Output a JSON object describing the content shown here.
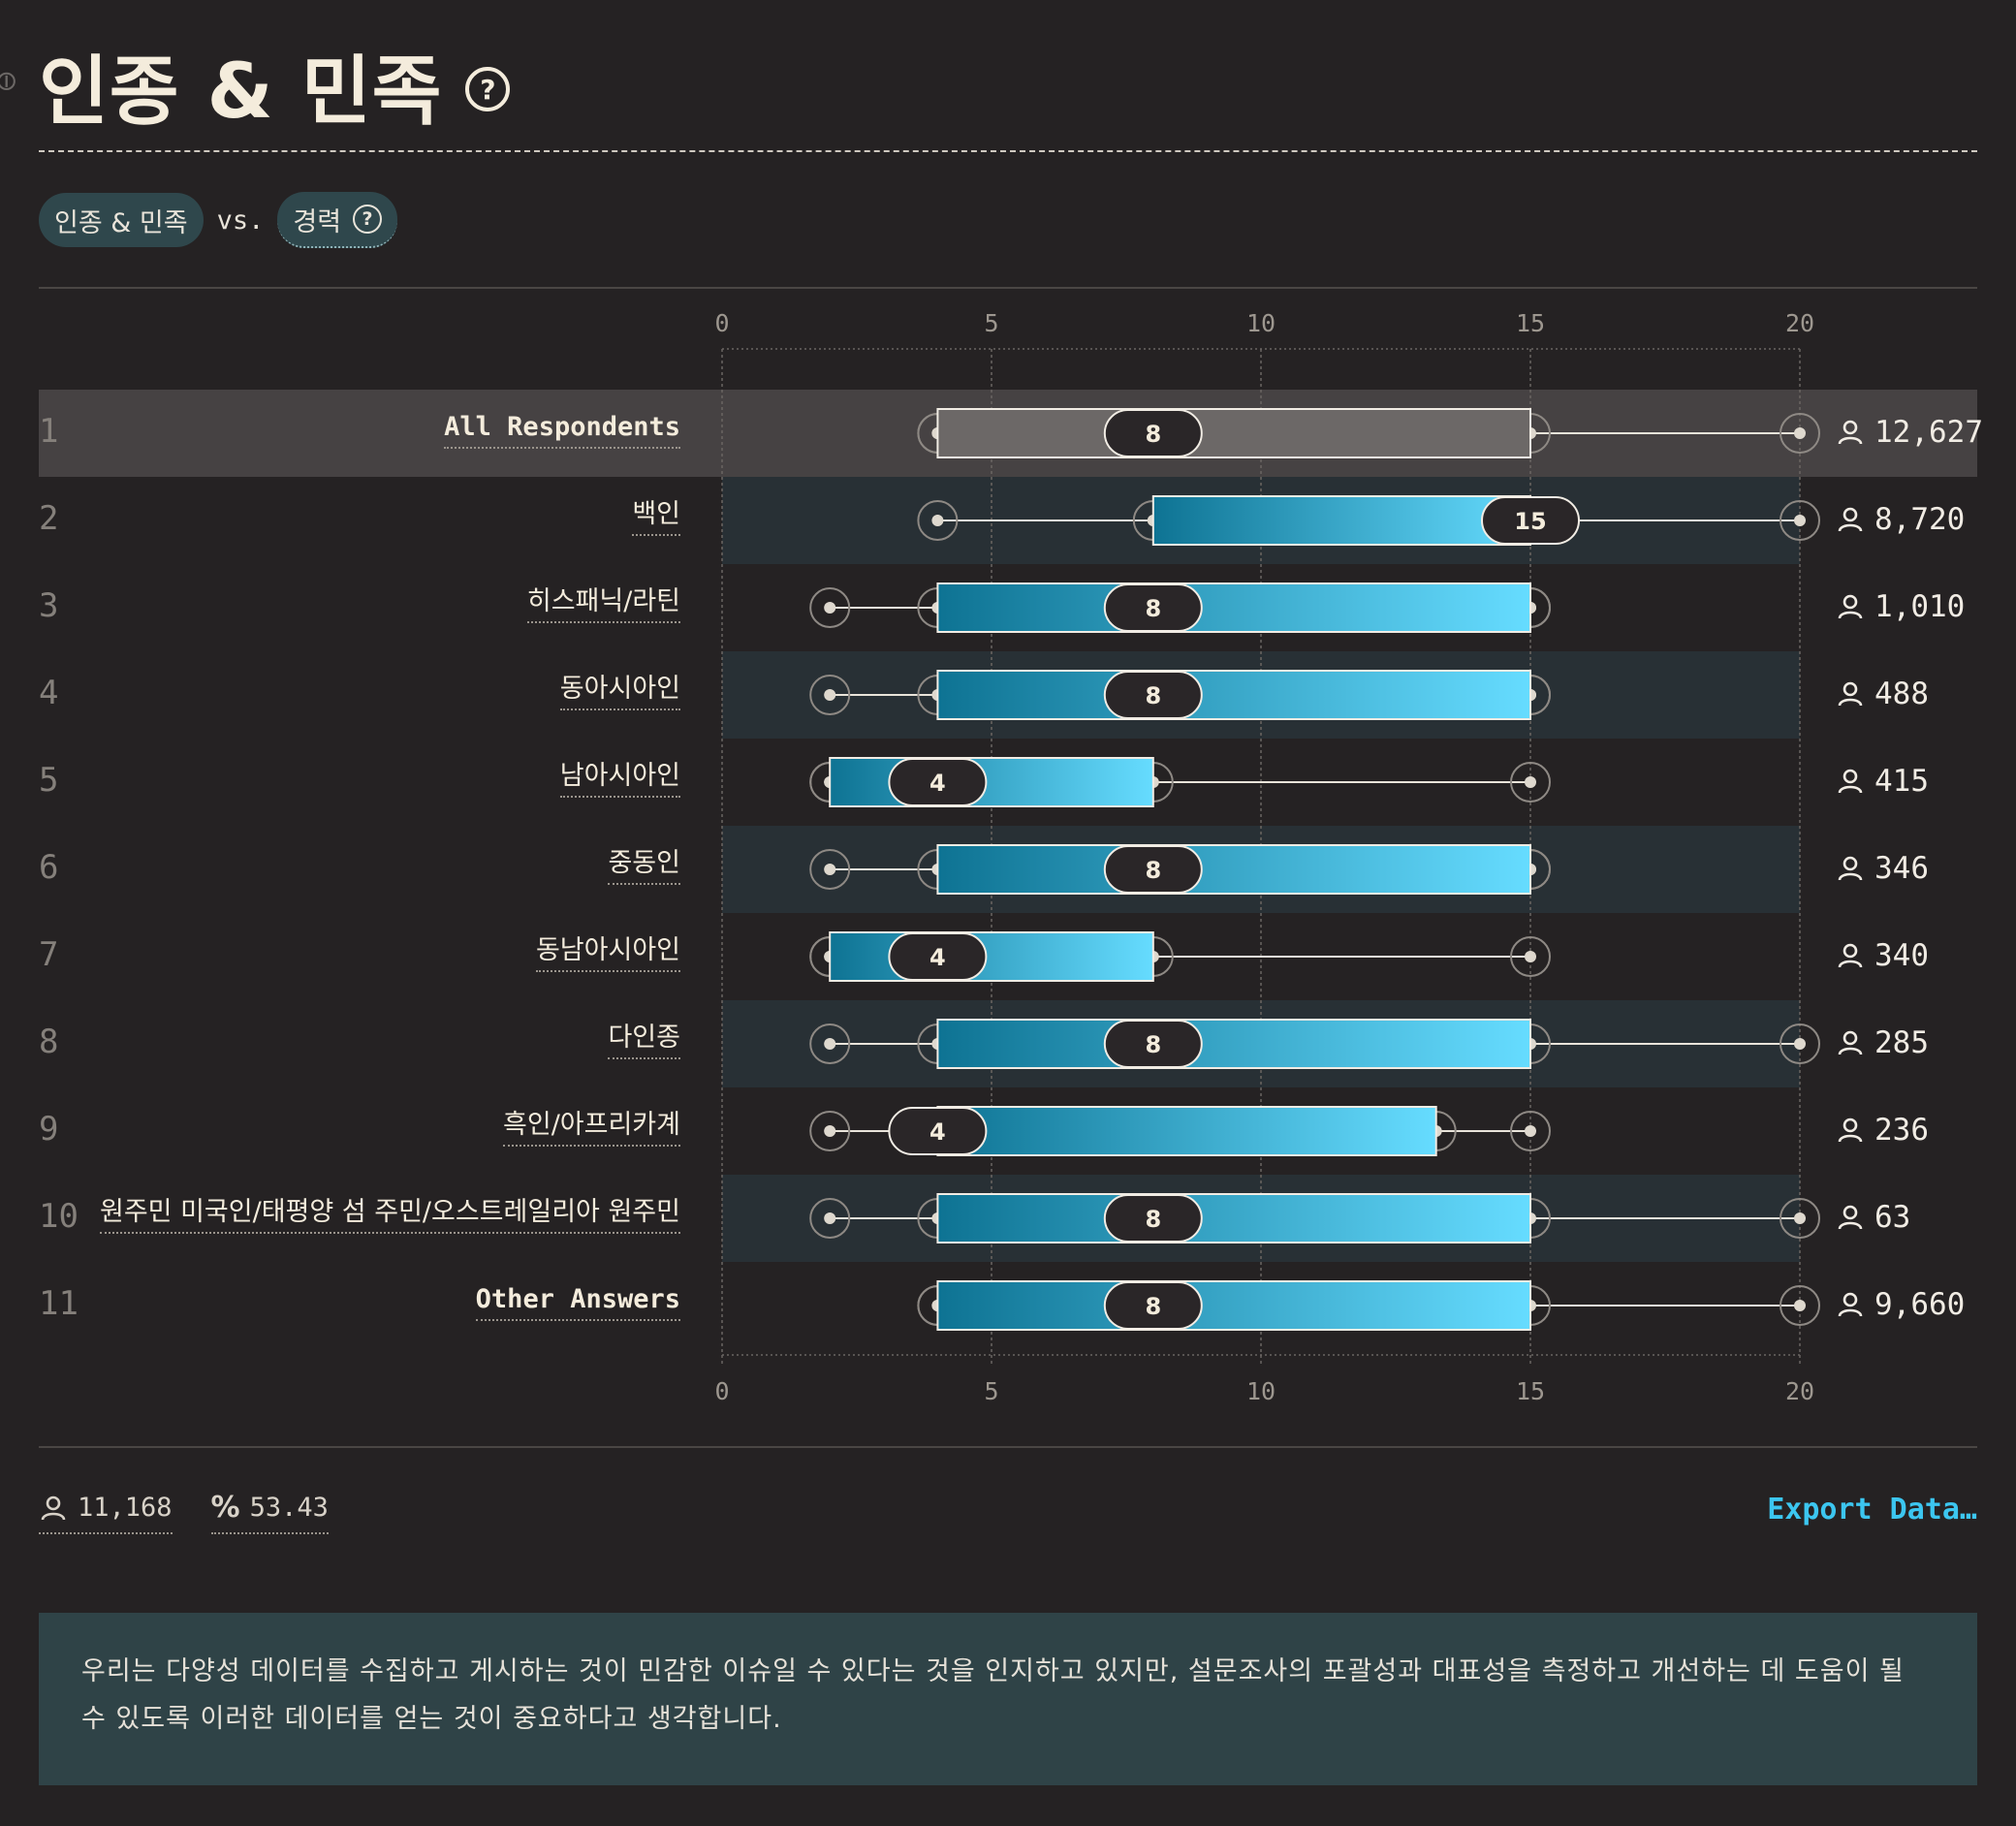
{
  "header": {
    "title": "인종 & 민족",
    "filter_primary": "인종 & 민족",
    "vs_label": "vs.",
    "filter_secondary": "경력"
  },
  "chart_data": {
    "type": "boxplot",
    "title": "인종 & 민족",
    "xlabel": "경력",
    "xlim": [
      0,
      20
    ],
    "xticks": [
      0,
      5,
      10,
      15,
      20
    ],
    "grid": true,
    "rows": [
      {
        "rank": "1",
        "label": "All Respondents",
        "min": 4,
        "q1": 4,
        "median": 8,
        "q3": 15,
        "max": 20,
        "count": "12,627",
        "highlight": true
      },
      {
        "rank": "2",
        "label": "백인",
        "min": 4,
        "q1": 8,
        "median": 15,
        "q3": 15,
        "max": 20,
        "count": "8,720"
      },
      {
        "rank": "3",
        "label": "히스패닉/라틴",
        "min": 2,
        "q1": 4,
        "median": 8,
        "q3": 15,
        "max": 15,
        "count": "1,010"
      },
      {
        "rank": "4",
        "label": "동아시아인",
        "min": 2,
        "q1": 4,
        "median": 8,
        "q3": 15,
        "max": 15,
        "count": "488"
      },
      {
        "rank": "5",
        "label": "남아시아인",
        "min": 2,
        "q1": 2,
        "median": 4,
        "q3": 8,
        "max": 15,
        "count": "415"
      },
      {
        "rank": "6",
        "label": "중동인",
        "min": 2,
        "q1": 4,
        "median": 8,
        "q3": 15,
        "max": 15,
        "count": "346"
      },
      {
        "rank": "7",
        "label": "동남아시아인",
        "min": 2,
        "q1": 2,
        "median": 4,
        "q3": 8,
        "max": 15,
        "count": "340"
      },
      {
        "rank": "8",
        "label": "다인종",
        "min": 2,
        "q1": 4,
        "median": 8,
        "q3": 15,
        "max": 20,
        "count": "285"
      },
      {
        "rank": "9",
        "label": "흑인/아프리카계",
        "min": 2,
        "q1": 4,
        "median": 4,
        "q3": 13.25,
        "max": 15,
        "count": "236"
      },
      {
        "rank": "10",
        "label": "원주민 미국인/태평양 섬 주민/오스트레일리아 원주민",
        "min": 2,
        "q1": 4,
        "median": 8,
        "q3": 15,
        "max": 20,
        "count": "63"
      },
      {
        "rank": "11",
        "label": "Other Answers",
        "min": 4,
        "q1": 4,
        "median": 8,
        "q3": 15,
        "max": 20,
        "count": "9,660"
      }
    ]
  },
  "footer": {
    "respondents": "11,168",
    "percent": "53.43",
    "export_label": "Export Data…"
  },
  "note": "우리는 다양성 데이터를 수집하고 게시하는 것이 민감한 이슈일 수 있다는 것을 인지하고 있지만, 설문조사의 포괄성과 대표성을 측정하고 개선하는 데 도움이 될 수 있도록 이러한 데이터를 얻는 것이 중요하다고 생각합니다.",
  "colors": {
    "background": "#252223",
    "band_dark": "#283035",
    "band_highlight": "#464243",
    "box_start": "#0e7393",
    "box_end": "#66dcff",
    "accent": "#3cc6f0"
  },
  "icons": {
    "person": "person-icon",
    "percent": "percent-icon",
    "help": "help-circle-icon",
    "link": "link-icon"
  }
}
